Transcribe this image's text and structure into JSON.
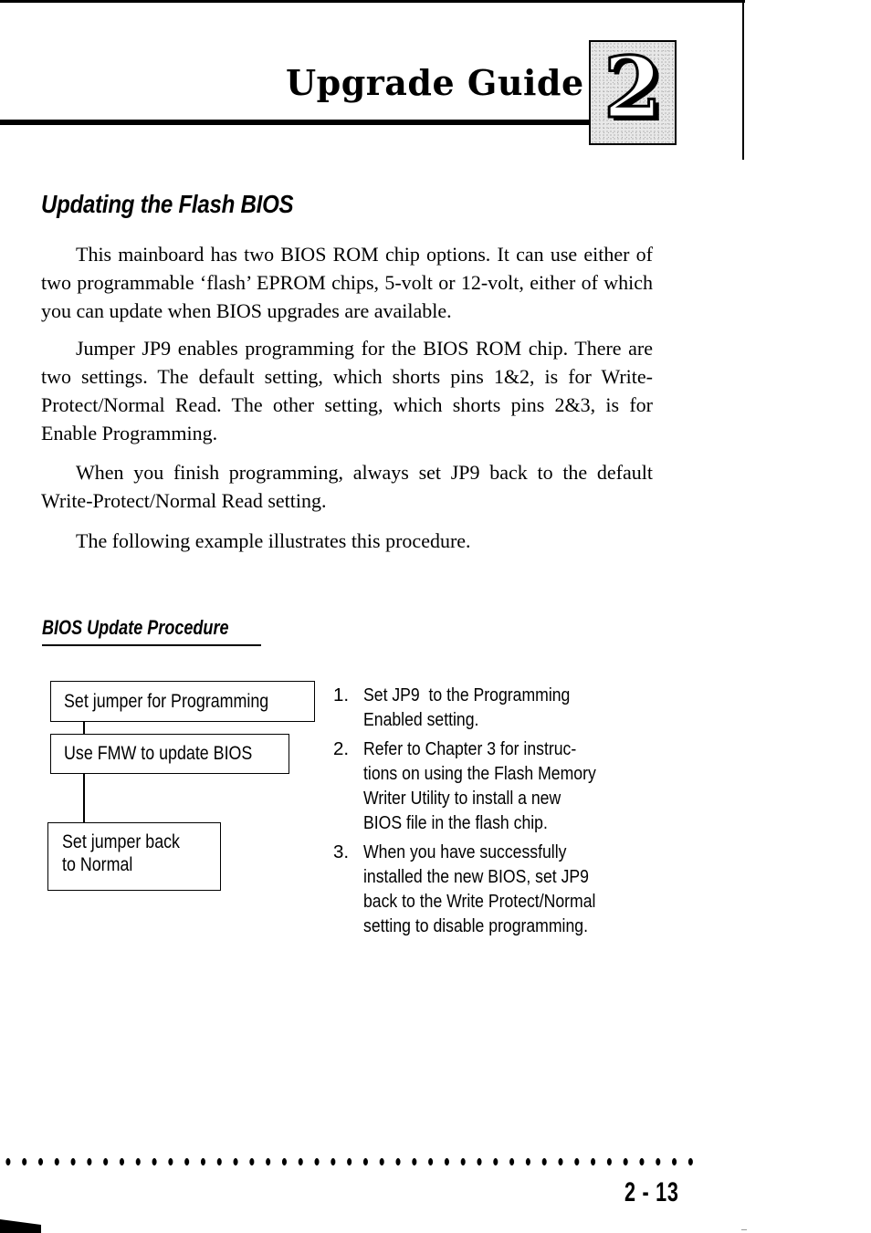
{
  "chapter": {
    "title": "Upgrade Guide",
    "number": "2"
  },
  "section": {
    "title": "Updating the Flash BIOS",
    "paragraphs": [
      "This mainboard has two BIOS ROM chip options. It can use either of two programmable ‘flash’ EPROM chips, 5-volt or 12-volt, either of which you can update when BIOS upgrades are available.",
      "Jumper JP9 enables programming for the BIOS ROM chip. There are two settings. The default setting, which shorts pins 1&2, is for Write-Protect/Normal Read. The other setting, which shorts pins 2&3, is for Enable Programming.",
      "When you finish programming, always set JP9 back to the default Write-Protect/Normal Read setting.",
      "The following example illustrates this procedure."
    ]
  },
  "procedure": {
    "title": "BIOS Update Procedure",
    "flowchart": [
      "Set jumper for Programming",
      "Use FMW to update BIOS",
      "Set jumper back to Normal"
    ],
    "steps": [
      {
        "num": "1.",
        "text": "Set JP9  to the Programming Enabled setting."
      },
      {
        "num": "2.",
        "text": "Refer to Chapter 3 for instructions on using the Flash Memory Writer Utility to install a new BIOS file in the flash chip."
      },
      {
        "num": "3.",
        "text": "When you have successfully installed the new BIOS, set JP9 back to the Write Protect/Normal setting to disable programming."
      }
    ]
  },
  "footer": {
    "page_number": "2 - 13"
  }
}
